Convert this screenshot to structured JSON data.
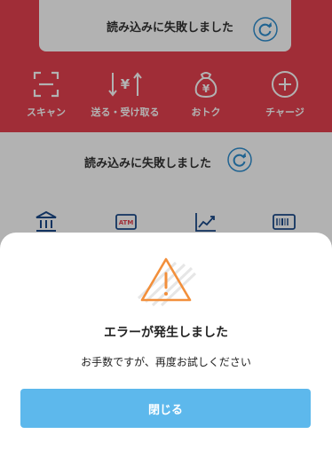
{
  "top_card": {
    "message": "読み込みに失敗しました",
    "reload_icon": "refresh-icon"
  },
  "actions": [
    {
      "label": "スキャン",
      "icon": "scan-icon"
    },
    {
      "label": "送る・受け取る",
      "icon": "send-receive-yen-icon"
    },
    {
      "label": "おトク",
      "icon": "money-bag-yen-icon"
    },
    {
      "label": "チャージ",
      "icon": "plus-circle-icon"
    }
  ],
  "status_row": {
    "message": "読み込みに失敗しました",
    "reload_icon": "refresh-icon"
  },
  "shortcuts": [
    {
      "icon": "bank-icon"
    },
    {
      "icon": "atm-icon",
      "text": "ATM"
    },
    {
      "icon": "chart-icon"
    },
    {
      "icon": "barcode-card-icon"
    }
  ],
  "error_sheet": {
    "icon": "warning-triangle-icon",
    "title": "エラーが発生しました",
    "message": "お手数ですが、再度お試しください",
    "close_label": "閉じる"
  },
  "colors": {
    "header_red": "#e5414f",
    "accent_blue": "#5db8ec",
    "warning_orange": "#f28f3b"
  }
}
